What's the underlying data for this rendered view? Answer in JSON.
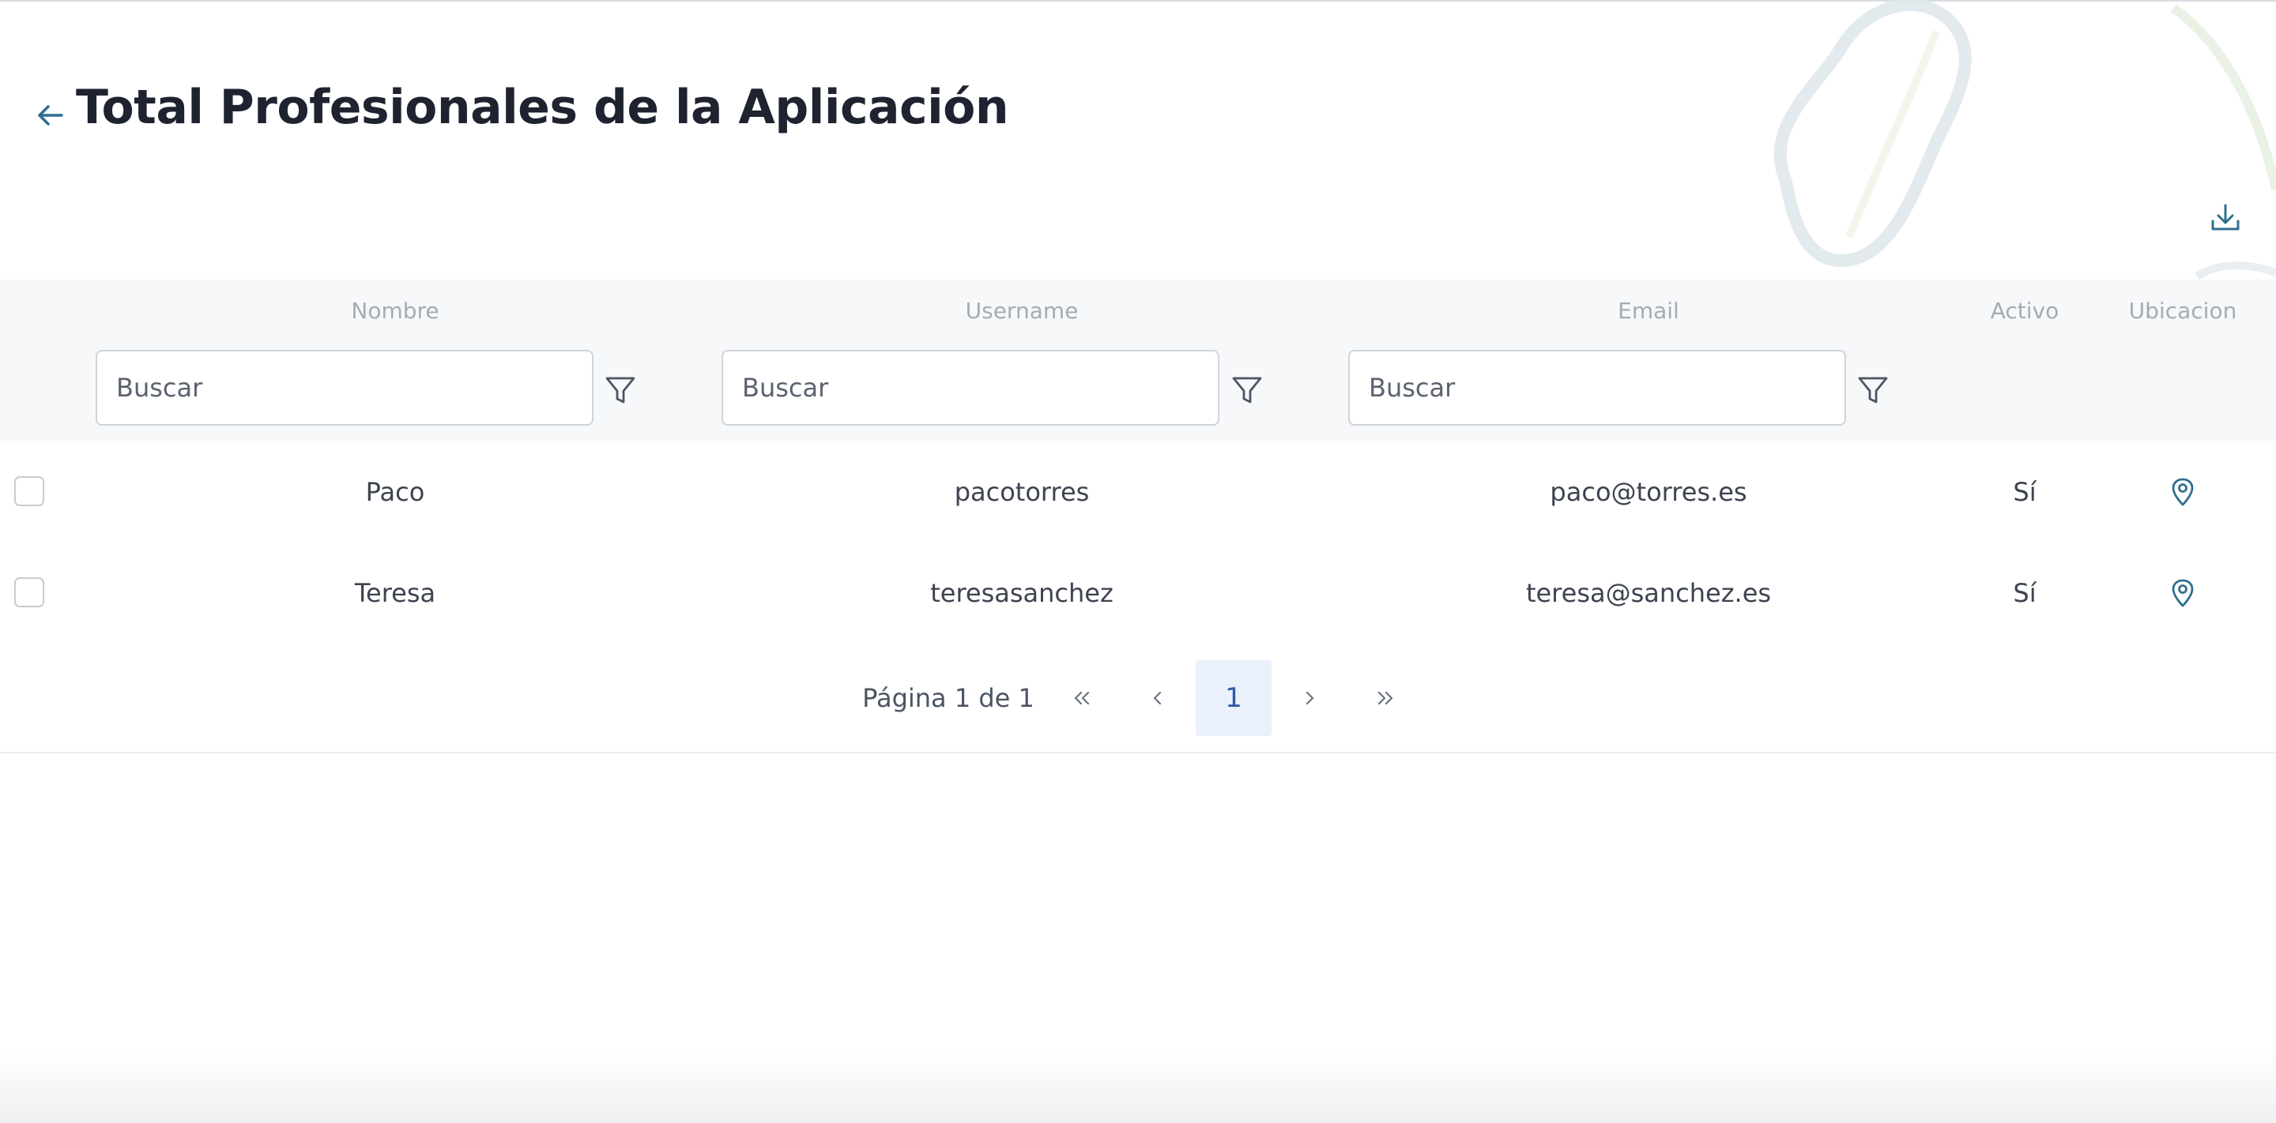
{
  "header": {
    "title": "Total Profesionales de la Aplicación",
    "back_icon": "arrow-left-icon",
    "download_icon": "download-icon"
  },
  "table": {
    "columns": [
      "Nombre",
      "Username",
      "Email",
      "Activo",
      "Ubicacion"
    ],
    "filters": {
      "nombre_placeholder": "Buscar",
      "username_placeholder": "Buscar",
      "email_placeholder": "Buscar",
      "filter_icon": "filter-icon"
    },
    "rows": [
      {
        "nombre": "Paco",
        "username": "pacotorres",
        "email": "paco@torres.es",
        "activo": "Sí",
        "ubicacion_icon": "map-pin-icon"
      },
      {
        "nombre": "Teresa",
        "username": "teresasanchez",
        "email": "teresa@sanchez.es",
        "activo": "Sí",
        "ubicacion_icon": "map-pin-icon"
      }
    ]
  },
  "pagination": {
    "info": "Página 1 de 1",
    "current_page": "1",
    "icons": [
      "chevrons-left-icon",
      "chevron-left-icon",
      "chevron-right-icon",
      "chevrons-right-icon"
    ]
  },
  "colors": {
    "accent": "#2f6f8f",
    "header_bg": "#f6f8fa",
    "current_page_bg": "#eaf1fb"
  }
}
